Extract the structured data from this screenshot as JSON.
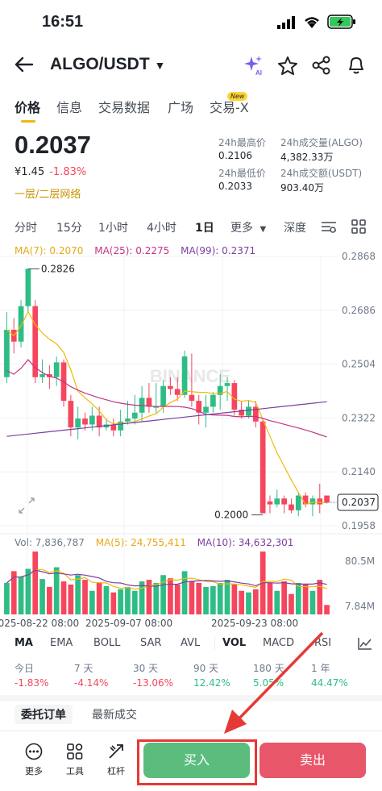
{
  "status": {
    "time": "16:51"
  },
  "header": {
    "pair": "ALGO/USDT",
    "caret": "▼"
  },
  "tabs": [
    "价格",
    "信息",
    "交易数据",
    "广场",
    "交易-X"
  ],
  "tab_badge": "New",
  "price": {
    "last": "0.2037",
    "fiat": "¥1.45",
    "change": "-1.83%",
    "tag": "一层/二层网络",
    "high_label": "24h最高价",
    "high": "0.2106",
    "low_label": "24h最低价",
    "low": "0.2033",
    "vol_algo_label": "24h成交量(ALGO)",
    "vol_algo": "4,382.33万",
    "vol_usdt_label": "24h成交额(USDT)",
    "vol_usdt": "903.40万"
  },
  "intervals": [
    "分时",
    "15分",
    "1小时",
    "4小时",
    "1日",
    "更多",
    "深度"
  ],
  "ma_legend": {
    "ma7": "MA(7): 0.2070",
    "ma25": "MA(25): 0.2275",
    "ma99": "MA(99): 0.2371"
  },
  "vol_legend": {
    "vol": "Vol: 7,836,787",
    "ma5": "MA(5): 24,755,411",
    "ma10": "MA(10): 34,632,301"
  },
  "watermark": "BINANCE",
  "chart_data": {
    "type": "candlestick",
    "y_ticks": [
      "0.2868",
      "0.2686",
      "0.2504",
      "0.2322",
      "0.2140",
      "0.1958"
    ],
    "ylim": [
      0.1958,
      0.2868
    ],
    "x_ticks": [
      "2025-08-22 08:00",
      "2025-09-07 08:00",
      "2025-09-23 08:00"
    ],
    "high_marker": "0.2826",
    "low_marker": "0.2000",
    "current_price": "0.2037",
    "vol_ticks": [
      "80.5M",
      "7.84M"
    ],
    "candles": [
      [
        0.246,
        0.262,
        0.268,
        0.244
      ],
      [
        0.262,
        0.258,
        0.266,
        0.254
      ],
      [
        0.258,
        0.27,
        0.272,
        0.256
      ],
      [
        0.27,
        0.2826,
        0.2826,
        0.268
      ],
      [
        0.27,
        0.246,
        0.272,
        0.244
      ],
      [
        0.246,
        0.247,
        0.252,
        0.244
      ],
      [
        0.247,
        0.246,
        0.25,
        0.242
      ],
      [
        0.246,
        0.251,
        0.253,
        0.243
      ],
      [
        0.251,
        0.238,
        0.252,
        0.236
      ],
      [
        0.238,
        0.229,
        0.24,
        0.226
      ],
      [
        0.229,
        0.232,
        0.236,
        0.225
      ],
      [
        0.232,
        0.23,
        0.234,
        0.228
      ],
      [
        0.23,
        0.233,
        0.236,
        0.228
      ],
      [
        0.233,
        0.229,
        0.236,
        0.226
      ],
      [
        0.229,
        0.23,
        0.232,
        0.228
      ],
      [
        0.23,
        0.228,
        0.232,
        0.226
      ],
      [
        0.228,
        0.231,
        0.235,
        0.226
      ],
      [
        0.231,
        0.232,
        0.238,
        0.23
      ],
      [
        0.232,
        0.234,
        0.24,
        0.23
      ],
      [
        0.234,
        0.239,
        0.243,
        0.231
      ],
      [
        0.239,
        0.236,
        0.244,
        0.234
      ],
      [
        0.236,
        0.236,
        0.244,
        0.234
      ],
      [
        0.236,
        0.243,
        0.245,
        0.234
      ],
      [
        0.243,
        0.242,
        0.246,
        0.24
      ],
      [
        0.242,
        0.24,
        0.246,
        0.238
      ],
      [
        0.24,
        0.253,
        0.255,
        0.239
      ],
      [
        0.24,
        0.238,
        0.254,
        0.236
      ],
      [
        0.238,
        0.234,
        0.24,
        0.23
      ],
      [
        0.234,
        0.236,
        0.24,
        0.229
      ],
      [
        0.236,
        0.24,
        0.241,
        0.234
      ],
      [
        0.24,
        0.243,
        0.247,
        0.235
      ],
      [
        0.243,
        0.244,
        0.246,
        0.238
      ],
      [
        0.244,
        0.235,
        0.245,
        0.233
      ],
      [
        0.235,
        0.233,
        0.238,
        0.232
      ],
      [
        0.233,
        0.236,
        0.238,
        0.232
      ],
      [
        0.236,
        0.231,
        0.238,
        0.229
      ],
      [
        0.231,
        0.2,
        0.232,
        0.2
      ],
      [
        0.204,
        0.203,
        0.206,
        0.2
      ],
      [
        0.203,
        0.205,
        0.208,
        0.202
      ],
      [
        0.205,
        0.203,
        0.206,
        0.2
      ],
      [
        0.203,
        0.201,
        0.205,
        0.2
      ],
      [
        0.201,
        0.206,
        0.207,
        0.199
      ],
      [
        0.206,
        0.203,
        0.207,
        0.202
      ],
      [
        0.203,
        0.205,
        0.206,
        0.199
      ],
      [
        0.205,
        0.203,
        0.21,
        0.2
      ],
      [
        0.206,
        0.2037,
        0.206,
        0.2033
      ]
    ],
    "volumes": [
      40,
      55,
      48,
      58,
      80,
      45,
      35,
      60,
      42,
      38,
      50,
      44,
      30,
      40,
      36,
      28,
      32,
      35,
      30,
      42,
      44,
      40,
      50,
      46,
      38,
      55,
      42,
      40,
      35,
      36,
      40,
      44,
      38,
      30,
      28,
      32,
      80,
      40,
      30,
      42,
      26,
      40,
      38,
      30,
      44,
      12
    ]
  },
  "indicators": [
    "MA",
    "EMA",
    "BOLL",
    "SAR",
    "AVL",
    "VOL",
    "MACD",
    "RSI"
  ],
  "performance": [
    {
      "label": "今日",
      "value": "-1.83%",
      "dir": "down"
    },
    {
      "label": "7 天",
      "value": "-4.14%",
      "dir": "down"
    },
    {
      "label": "30 天",
      "value": "-13.06%",
      "dir": "down"
    },
    {
      "label": "90 天",
      "value": "12.42%",
      "dir": "up"
    },
    {
      "label": "180 天",
      "value": "5.05%",
      "dir": "up"
    },
    {
      "label": "1 年",
      "value": "44.47%",
      "dir": "up"
    }
  ],
  "order_tabs": [
    "委托订单",
    "最新成交"
  ],
  "bottom": {
    "more": "更多",
    "tools": "工具",
    "leverage": "杠杆",
    "buy": "买入",
    "sell": "卖出"
  },
  "colors": {
    "up": "#2ebd85",
    "down": "#f6465d",
    "ma7": "#f0b90b",
    "ma25": "#c13584",
    "ma99": "#7b3fa0",
    "accent": "#f0b90b"
  }
}
